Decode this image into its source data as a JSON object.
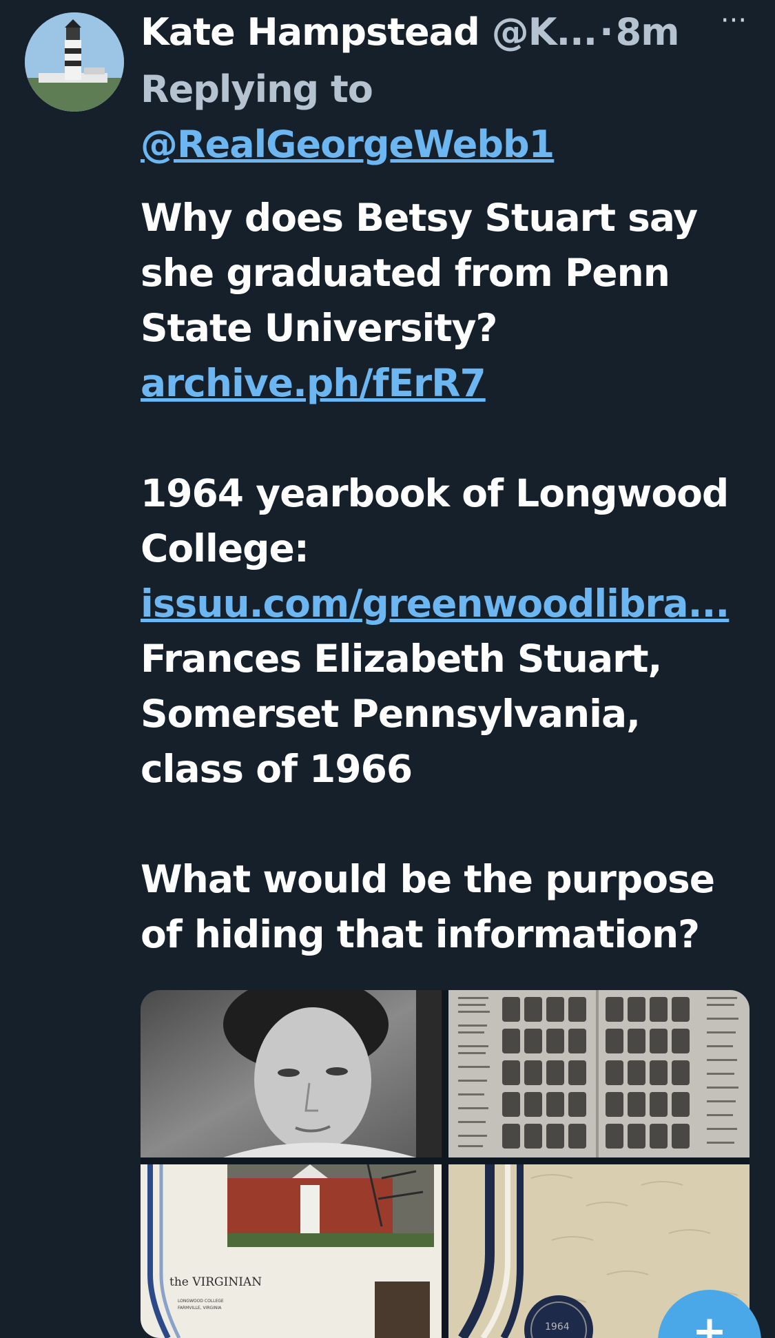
{
  "author": {
    "name": "Kate Hampstead",
    "handle": "@K...",
    "separator": "·",
    "time": "8m"
  },
  "more_label": "···",
  "reply": {
    "prefix": "Replying to",
    "mention": "@RealGeorgeWebb1"
  },
  "body": {
    "line1": "Why does Betsy Stuart say",
    "line2": "she graduated from Penn",
    "line3": "State University?",
    "link1": "archive.ph/fErR7",
    "line5": "1964 yearbook of Longwood",
    "line6": "College:",
    "link2": "issuu.com/greenwoodlibra...",
    "line8": "Frances Elizabeth Stuart,",
    "line9": "Somerset Pennsylvania,",
    "line10": "class of 1966",
    "line12": "What would be the purpose",
    "line13": "of hiding that information?"
  },
  "media": {
    "yearbook_cover_title": "the VIRGINIAN",
    "yearbook_cover_sub1": "LONGWOOD COLLEGE",
    "yearbook_cover_sub2": "FARMVILLE, VIRGINIA",
    "seal_year": "1964"
  },
  "fab_label": "+",
  "colors": {
    "background": "#15202b",
    "link": "#6cb6f2",
    "secondary_text": "#b5c2cf",
    "fab": "#4aa8e8"
  }
}
